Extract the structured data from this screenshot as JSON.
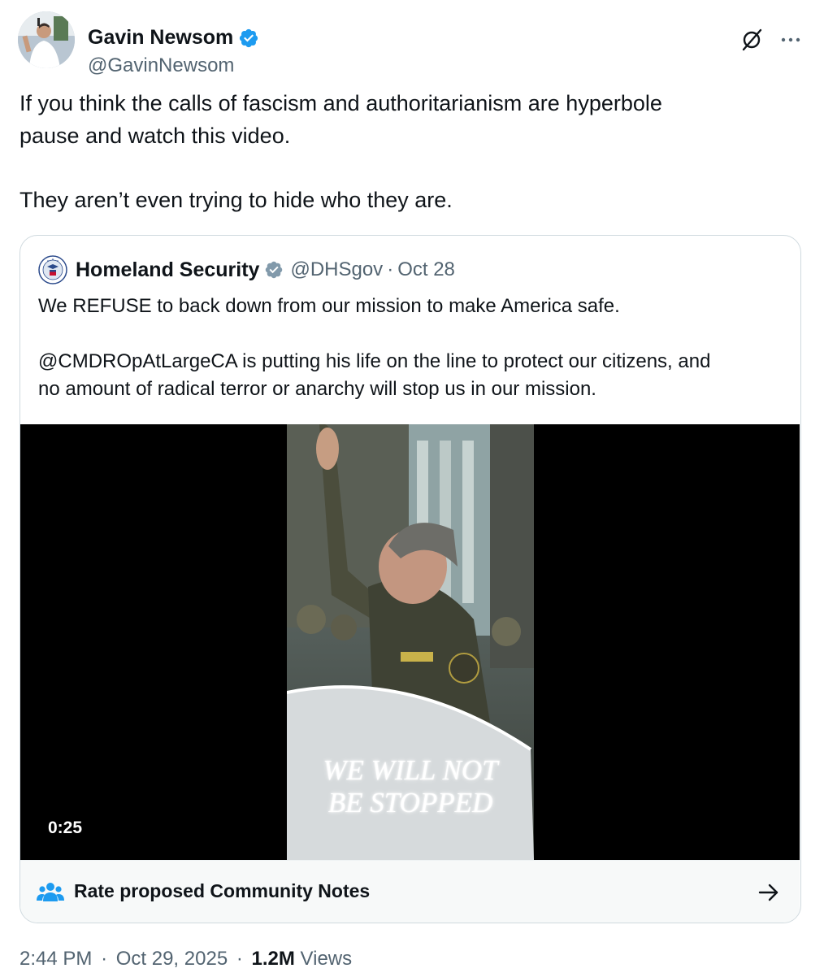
{
  "author": {
    "display_name": "Gavin Newsom",
    "handle": "@GavinNewsom",
    "verified_icon": "blue-verified-badge",
    "accent": "#1d9bf0"
  },
  "header_icons": {
    "grok": "grok-icon",
    "more": "more-icon"
  },
  "tweet": {
    "lines": [
      "If you think the calls of fascism and authoritarianism are hyperbole",
      "pause and watch this video.",
      "They aren’t even trying to hide who they are."
    ]
  },
  "quote": {
    "display_name": "Homeland Security",
    "handle": "@DHSgov",
    "separator": "·",
    "date": "Oct 28",
    "badge_icon": "gray-government-badge",
    "text": {
      "p1": "We REFUSE to back down from our mission to make America safe.",
      "p2_line1": "@CMDROpAtLargeCA is putting his life on the line to protect our citizens, and",
      "p2_line2": "no amount of radical terror or anarchy will stop us in our mission."
    },
    "video": {
      "caption_line1": "WE WILL NOT",
      "caption_line2": "BE STOPPED",
      "duration": "0:25"
    },
    "community_notes": {
      "label": "Rate proposed Community Notes",
      "icon": "people-icon",
      "arrow_icon": "arrow-right-icon"
    }
  },
  "meta": {
    "time": "2:44 PM",
    "sep1": "·",
    "date": "Oct 29, 2025",
    "sep2": "·",
    "views_count": "1.2M",
    "views_label": "Views"
  }
}
